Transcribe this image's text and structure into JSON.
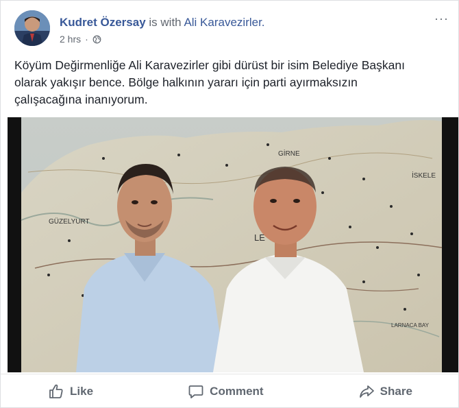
{
  "post": {
    "author": "Kudret Özersay",
    "with_text": "is with",
    "tagged": "Ali Karavezirler.",
    "time": "2 hrs",
    "time_separator": "·",
    "privacy_icon": "globe-icon",
    "menu": "···",
    "text_lines": [
      "Köyüm Değirmenliğe Ali Karavezirler gibi dürüst bir isim Belediye Başkanı",
      "olarak yakışır bence. Bölge halkının yararı için parti ayırmaksızın",
      "çalışacağına inanıyorum."
    ]
  },
  "photo": {
    "map_labels": [
      "GİRNE",
      "GÜZELYURT",
      "İSKELE",
      "LE",
      "LARNACA BAY"
    ]
  },
  "actions": {
    "like": "Like",
    "comment": "Comment",
    "share": "Share"
  },
  "colors": {
    "link": "#385898",
    "muted": "#606770",
    "text": "#1d2129"
  }
}
